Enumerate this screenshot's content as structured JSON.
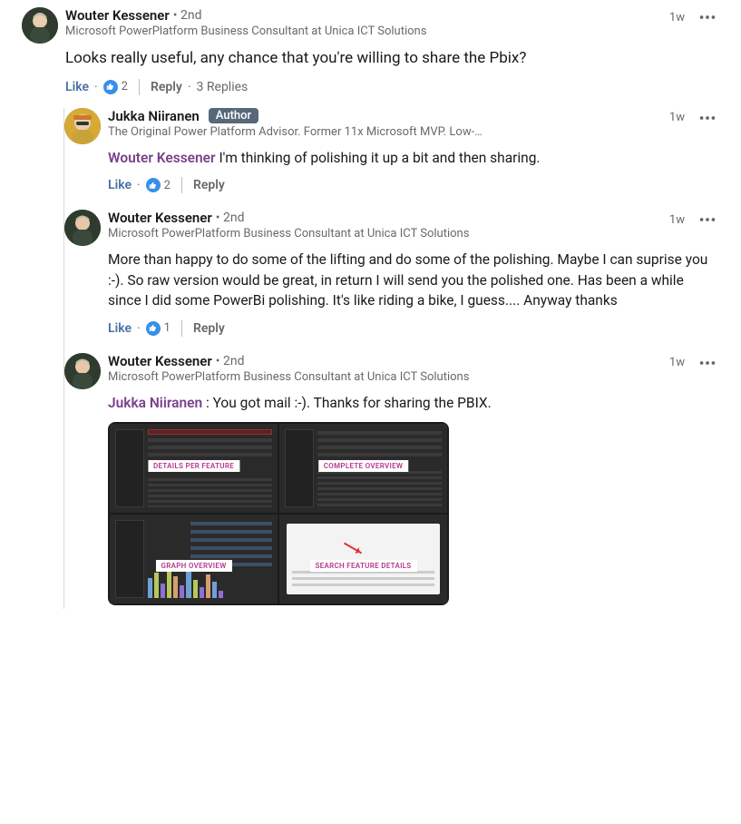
{
  "main": {
    "author": "Wouter Kessener",
    "degree": "• 2nd",
    "subtitle": "Microsoft PowerPlatform Business Consultant at Unica ICT Solutions",
    "time": "1w",
    "body": "Looks really useful, any chance that you're willing to share the Pbix?",
    "like_label": "Like",
    "reply_label": "Reply",
    "reactions": "2",
    "replies_text": "3 Replies"
  },
  "reply1": {
    "author": "Jukka Niiranen",
    "author_badge": "Author",
    "subtitle": "The Original Power Platform Advisor. Former 11x Microsoft MVP. Low-…",
    "time": "1w",
    "mention": "Wouter Kessener",
    "body_rest": " I'm thinking of polishing it up a bit and then sharing.",
    "like_label": "Like",
    "reply_label": "Reply",
    "reactions": "2"
  },
  "reply2": {
    "author": "Wouter Kessener",
    "degree": "• 2nd",
    "subtitle": "Microsoft PowerPlatform Business Consultant at Unica ICT Solutions",
    "time": "1w",
    "body": "More than happy to do some of the lifting and do some of the polishing. Maybe I can suprise you :-). So raw version would be great, in return I will send you the polished one. Has been a while since I did some PowerBi polishing. It's like riding a bike, I guess.... Anyway thanks",
    "like_label": "Like",
    "reply_label": "Reply",
    "reactions": "1"
  },
  "reply3": {
    "author": "Wouter Kessener",
    "degree": "• 2nd",
    "subtitle": "Microsoft PowerPlatform Business Consultant at Unica ICT Solutions",
    "time": "1w",
    "mention": "Jukka Niiranen",
    "body_rest": " : You got mail :-). Thanks for sharing the PBIX.",
    "dash_labels": {
      "q1": "DETAILS PER FEATURE",
      "q2": "COMPLETE OVERVIEW",
      "q3": "GRAPH OVERVIEW",
      "q4": "SEARCH FEATURE DETAILS"
    }
  },
  "icons": {
    "overflow": "more-icon",
    "like": "thumb-icon"
  }
}
